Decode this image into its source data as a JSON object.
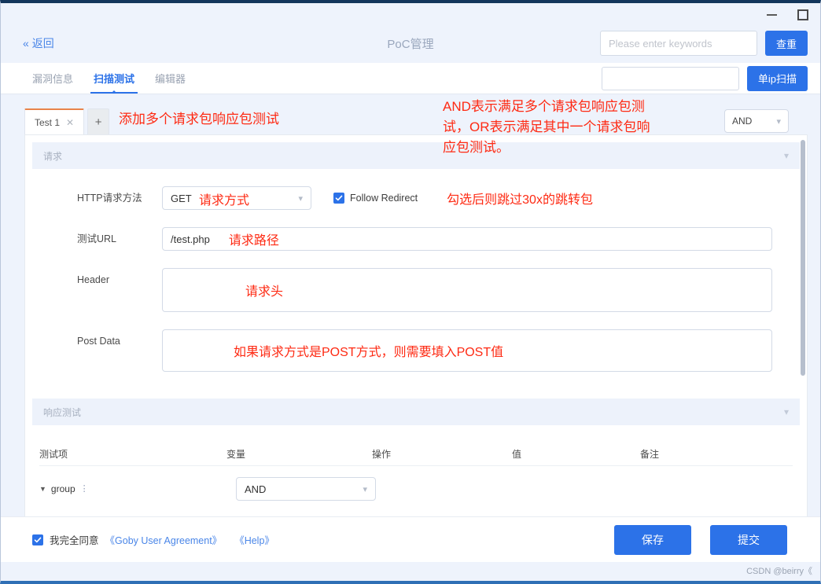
{
  "window": {
    "minimize_icon": "minimize-icon",
    "maximize_icon": "maximize-icon"
  },
  "header": {
    "back_label": "返回",
    "back_icon": "double-chevron-left-icon",
    "title": "PoC管理",
    "search_placeholder": "Please enter keywords",
    "search_value": "",
    "search_button": "查重"
  },
  "tabbar": {
    "tabs": [
      {
        "label": "漏洞信息",
        "active": false
      },
      {
        "label": "扫描测试",
        "active": true
      },
      {
        "label": "编辑器",
        "active": false
      }
    ],
    "scan_input_value": "",
    "scan_button": "单ip扫描"
  },
  "panel": {
    "test_tab_label": "Test 1",
    "test_tab_close_icon": "close-icon",
    "add_tab_label": "+",
    "logic_select_value": "AND",
    "logic_select_icon": "chevron-down-icon"
  },
  "annotations": {
    "add_tabs": "添加多个请求包响应包测试",
    "logic": "AND表示满足多个请求包响应包测\n试，OR表示满足其中一个请求包响\n应包测试。",
    "method": "请求方式",
    "url": "请求路径",
    "follow_redirect": "勾选后则跳过30x的跳转包",
    "header": "请求头",
    "post_data": "如果请求方式是POST方式，则需要填入POST值"
  },
  "request_section": {
    "title": "请求",
    "collapse_icon": "chevron-down-icon",
    "method_label": "HTTP请求方法",
    "method_value": "GET",
    "method_icon": "chevron-down-icon",
    "follow_redirect_label": "Follow Redirect",
    "follow_redirect_checked": true,
    "url_label": "测试URL",
    "url_value": "/test.php",
    "header_label": "Header",
    "header_value": "",
    "post_data_label": "Post Data",
    "post_data_value": ""
  },
  "response_section": {
    "title": "响应测试",
    "collapse_icon": "chevron-down-icon",
    "columns": [
      "测试项",
      "变量",
      "操作",
      "值",
      "备注"
    ],
    "rows": [
      {
        "name": "group",
        "drag_icon": "drag-handle-icon",
        "caret_icon": "caret-down-icon",
        "variable": "AND",
        "variable_icon": "chevron-down-icon"
      }
    ]
  },
  "footer": {
    "agree_checked": true,
    "agree_text": "我完全同意",
    "agreement_link": "《Goby User Agreement》",
    "help_link": "《Help》",
    "save_button": "保存",
    "submit_button": "提交"
  },
  "watermark": "CSDN @beirry《"
}
